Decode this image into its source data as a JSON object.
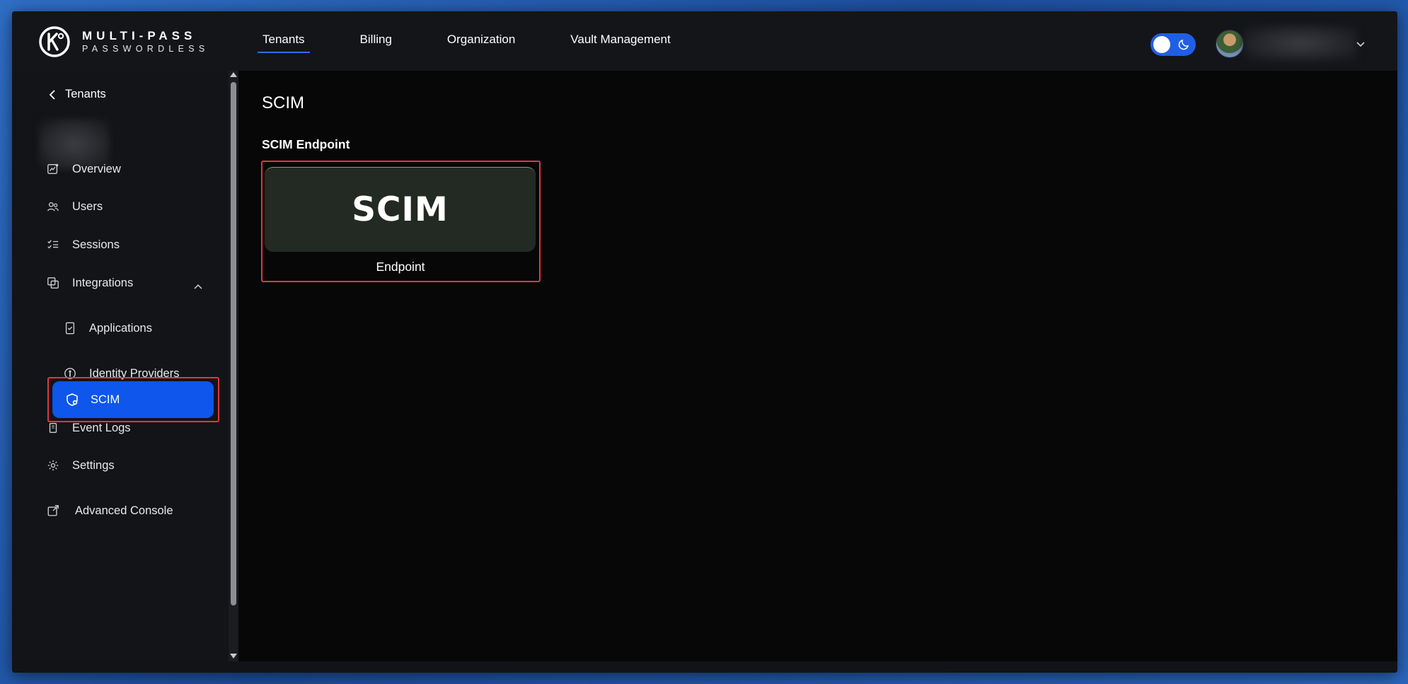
{
  "brand": {
    "title": "MULTI-PASS",
    "subtitle": "PASSWORDLESS"
  },
  "topnav": {
    "items": [
      {
        "label": "Tenants",
        "active": true
      },
      {
        "label": "Billing",
        "active": false
      },
      {
        "label": "Organization",
        "active": false
      },
      {
        "label": "Vault Management",
        "active": false
      }
    ]
  },
  "theme": {
    "mode": "dark",
    "icon": "moon-icon"
  },
  "sidebar": {
    "back_label": "Tenants",
    "items": [
      {
        "label": "Overview",
        "icon": "chart-icon"
      },
      {
        "label": "Users",
        "icon": "users-icon"
      },
      {
        "label": "Sessions",
        "icon": "checklist-icon"
      },
      {
        "label": "Integrations",
        "icon": "layers-icon",
        "expanded": true
      },
      {
        "label": "Applications",
        "icon": "phone-check-icon"
      },
      {
        "label": "Identity Providers",
        "icon": "id-badge-icon"
      },
      {
        "label": "SCIM",
        "icon": "shield-plus-icon",
        "active": true
      },
      {
        "label": "Event Logs",
        "icon": "document-icon"
      },
      {
        "label": "Settings",
        "icon": "gear-icon"
      },
      {
        "label": "Advanced Console",
        "icon": "external-link-icon"
      }
    ]
  },
  "main": {
    "title": "SCIM",
    "section_title": "SCIM Endpoint",
    "card": {
      "logo_text": "SCIM",
      "label": "Endpoint"
    }
  },
  "colors": {
    "accent": "#0e56ec",
    "highlight_border": "#e0373d",
    "card_bg": "#232a23",
    "background": "#070708"
  }
}
